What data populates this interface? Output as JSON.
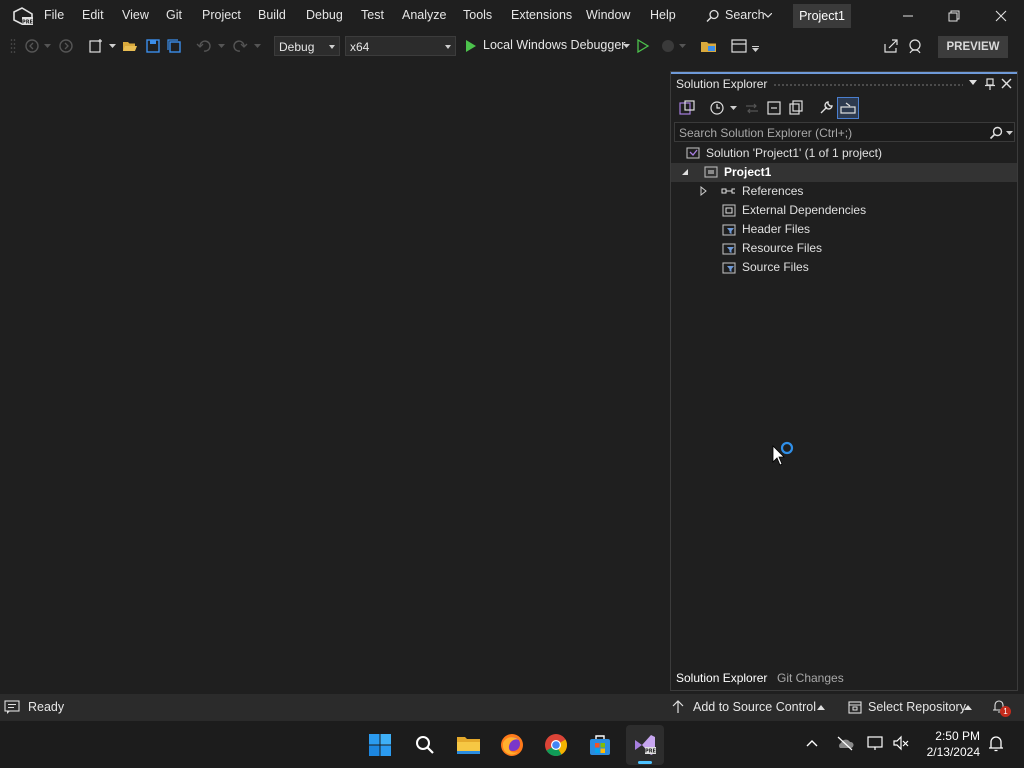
{
  "menu": {
    "items": [
      "File",
      "Edit",
      "View",
      "Git",
      "Project",
      "Build",
      "Debug",
      "Test",
      "Analyze",
      "Tools",
      "Extensions",
      "Window",
      "Help"
    ],
    "search_label": "Search",
    "project_tab": "Project1"
  },
  "toolbar": {
    "config": "Debug",
    "platform": "x64",
    "debugger_label": "Local Windows Debugger",
    "preview_label": "PREVIEW"
  },
  "solution_explorer": {
    "title": "Solution Explorer",
    "search_placeholder": "Search Solution Explorer (Ctrl+;)",
    "solution_label": "Solution 'Project1' (1 of 1 project)",
    "project_label": "Project1",
    "items": [
      "References",
      "External Dependencies",
      "Header Files",
      "Resource Files",
      "Source Files"
    ],
    "tabs": [
      "Solution Explorer",
      "Git Changes"
    ]
  },
  "statusbar": {
    "status": "Ready",
    "source_control": "Add to Source Control",
    "repository": "Select Repository",
    "notification_count": "1"
  },
  "taskbar": {
    "time": "2:50 PM",
    "date": "2/13/2024"
  },
  "colors": {
    "background": "#1f1f1f",
    "accent": "#6f9ad8",
    "vs_purple": "#a77fe0",
    "play_green": "#4cc24c"
  }
}
